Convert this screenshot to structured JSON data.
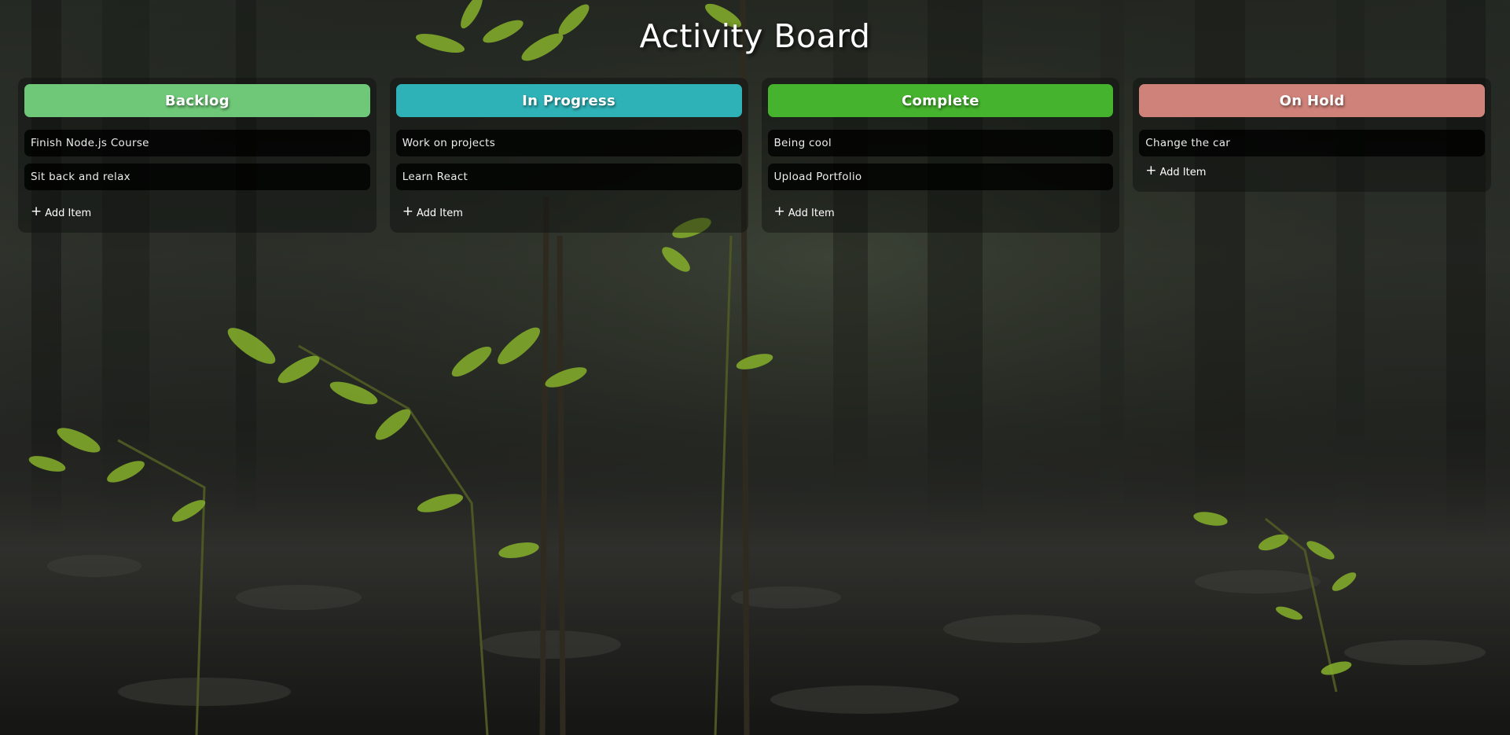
{
  "board": {
    "title": "Activity Board"
  },
  "columns": [
    {
      "name": "Backlog",
      "color": "#6fc878",
      "items": [
        "Finish Node.js Course",
        "Sit back and relax"
      ],
      "add_label": "Add Item"
    },
    {
      "name": "In Progress",
      "color": "#2fb2b7",
      "items": [
        "Work on projects",
        "Learn React"
      ],
      "add_label": "Add Item"
    },
    {
      "name": "Complete",
      "color": "#46b32e",
      "items": [
        "Being cool",
        "Upload Portfolio"
      ],
      "add_label": "Add Item"
    },
    {
      "name": "On Hold",
      "color": "#cf8279",
      "items": [
        "Change the car"
      ],
      "add_label": "Add Item"
    }
  ],
  "icons": {
    "add": "plus-icon"
  }
}
